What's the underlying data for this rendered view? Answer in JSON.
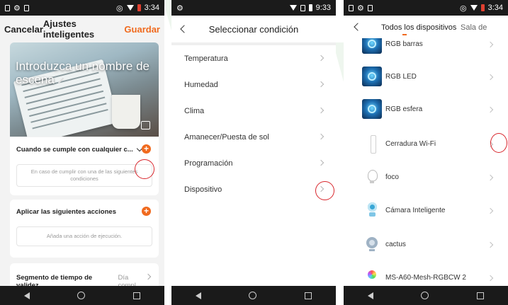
{
  "screen1": {
    "status_time": "3:34",
    "header": {
      "cancel": "Cancelar",
      "title": "Ajustes inteligentes",
      "save": "Guardar"
    },
    "hero_title": "Introduzca un nombre de escena",
    "condition": {
      "label": "Cuando se cumple con cualquier c...",
      "hint": "En caso de cumplir con una de las siguientes condiciones"
    },
    "actions": {
      "label": "Aplicar las siguientes acciones",
      "hint": "Añada una acción de ejecución."
    },
    "validity": {
      "label": "Segmento de tiempo de validez",
      "value": "Día compl..."
    },
    "accent_color": "#f06a1e"
  },
  "screen2": {
    "status_time": "9:33",
    "title": "Seleccionar condición",
    "items": [
      {
        "label": "Temperatura"
      },
      {
        "label": "Humedad"
      },
      {
        "label": "Clima"
      },
      {
        "label": "Amanecer/Puesta de sol"
      },
      {
        "label": "Programación"
      },
      {
        "label": "Dispositivo"
      }
    ]
  },
  "screen3": {
    "status_time": "3:34",
    "tabs": [
      {
        "label": "Todos los dispositivos"
      },
      {
        "label": "Sala de"
      }
    ],
    "devices": [
      {
        "name": "RGB barras",
        "icon": "rgb-icon"
      },
      {
        "name": "RGB LED",
        "icon": "rgb-icon"
      },
      {
        "name": "RGB esfera",
        "icon": "rgb-icon"
      },
      {
        "name": "Cerradura Wi-Fi",
        "icon": "lock-icon"
      },
      {
        "name": "foco",
        "icon": "bulb-icon"
      },
      {
        "name": "Cámara Inteligente",
        "icon": "camera-icon"
      },
      {
        "name": "cactus",
        "icon": "lamp-icon"
      },
      {
        "name": "MS-A60-Mesh-RGBCW 2",
        "icon": "bulb-color-icon"
      }
    ]
  },
  "highlight_color": "#d8262c"
}
